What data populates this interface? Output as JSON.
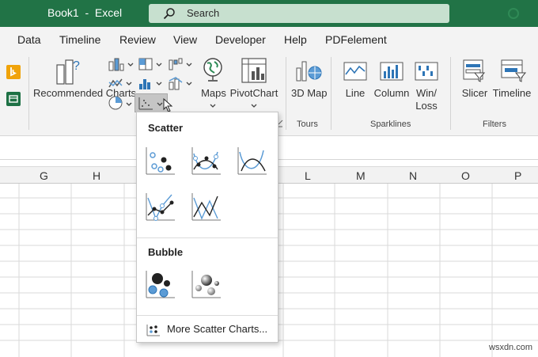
{
  "titlebar": {
    "title": "Book1  -  Excel",
    "search_placeholder": "Search"
  },
  "tabs": [
    "Data",
    "Timeline",
    "Review",
    "View",
    "Developer",
    "Help",
    "PDFelement"
  ],
  "ribbon": {
    "recommended_charts": "Recommended Charts",
    "maps": "Maps",
    "pivotchart": "PivotChart",
    "map3d": "3D Map",
    "line": "Line",
    "column": "Column",
    "winloss": "Win/ Loss",
    "slicer": "Slicer",
    "timeline": "Timeline",
    "groups": {
      "tours": "Tours",
      "sparklines": "Sparklines",
      "filters": "Filters"
    }
  },
  "columns": [
    "G",
    "H",
    "L",
    "M",
    "N",
    "O",
    "P"
  ],
  "dropdown": {
    "scatter_heading": "Scatter",
    "bubble_heading": "Bubble",
    "more_label": "More Scatter Charts..."
  },
  "watermark": "wsxdn.com",
  "colors": {
    "excel_green": "#217346",
    "search_box": "#c7e0cf",
    "chart_blue": "#5b9bd5",
    "chart_dark": "#222222"
  }
}
